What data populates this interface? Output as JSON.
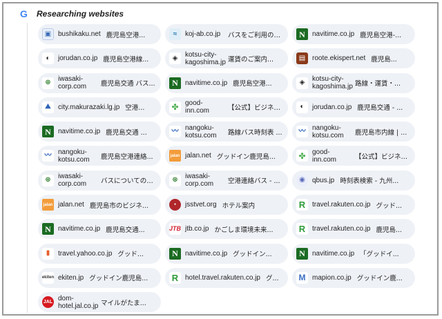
{
  "header": {
    "title": "Researching websites"
  },
  "sources": [
    {
      "domain": "bushikaku.net",
      "desc": "鹿児島空港...",
      "icon": "box-icon",
      "fav": "f-box",
      "glyph": "▣"
    },
    {
      "domain": "koj-ab.co.jp",
      "desc": "バスをご利用の方 ...",
      "icon": "wave-icon",
      "fav": "f-koj",
      "glyph": "≈",
      "wrap": true
    },
    {
      "domain": "navitime.co.jp",
      "desc": "鹿児島空港-...",
      "icon": "navitime-icon",
      "fav": "f-navi",
      "glyph": "N"
    },
    {
      "domain": "jorudan.co.jp",
      "desc": "鹿児島空港線...",
      "icon": "jorudan-icon",
      "fav": "f-jorudan",
      "glyph": "◐"
    },
    {
      "domain": "kotsu-city-kagoshima.jp",
      "desc": "運賃のご案内...",
      "icon": "kotsu-city-icon",
      "fav": "f-kotsu",
      "glyph": "◈",
      "wrap": true
    },
    {
      "domain": "roote.ekispert.net",
      "desc": "鹿児島...",
      "icon": "roote-icon",
      "fav": "f-roote",
      "glyph": "▤"
    },
    {
      "domain": "iwasaki-corp.com",
      "desc": "鹿児島交通 バス...",
      "icon": "iwasaki-icon",
      "fav": "f-iwasaki",
      "glyph": "⊛",
      "wrap": true
    },
    {
      "domain": "navitime.co.jp",
      "desc": "鹿児島空港...",
      "icon": "navitime-icon",
      "fav": "f-navi",
      "glyph": "N"
    },
    {
      "domain": "kotsu-city-kagoshima.jp",
      "desc": "路線・運賃・...",
      "icon": "kotsu-city-icon",
      "fav": "f-kotsu",
      "glyph": "◈",
      "wrap": true
    },
    {
      "domain": "city.makurazaki.lg.jp",
      "desc": "空港...",
      "icon": "city-makurazaki-icon",
      "fav": "f-city",
      "glyph": "⛰"
    },
    {
      "domain": "good-inn.com",
      "desc": "【公式】ビジネス...",
      "icon": "clover-icon",
      "fav": "f-good",
      "glyph": "✤",
      "wrap": true
    },
    {
      "domain": "jorudan.co.jp",
      "desc": "鹿児島交通 - ...",
      "icon": "jorudan-icon",
      "fav": "f-jorudan",
      "glyph": "◐"
    },
    {
      "domain": "navitime.co.jp",
      "desc": "鹿児島交通 ...",
      "icon": "navitime-icon",
      "fav": "f-navi",
      "glyph": "N"
    },
    {
      "domain": "nangoku-kotsu.com",
      "desc": "路線バス時刻表 ...",
      "icon": "nangoku-icon",
      "fav": "f-nangoku",
      "glyph": "〰",
      "wrap": true
    },
    {
      "domain": "nangoku-kotsu.com",
      "desc": "鹿児島市内線 | ...",
      "icon": "nangoku-icon",
      "fav": "f-nangoku",
      "glyph": "〰",
      "wrap": true
    },
    {
      "domain": "nangoku-kotsu.com",
      "desc": "鹿児島空港連絡...",
      "icon": "nangoku-icon",
      "fav": "f-nangoku",
      "glyph": "〰",
      "wrap": true
    },
    {
      "domain": "jalan.net",
      "desc": "グッドイン鹿児島...",
      "icon": "jalan-icon",
      "fav": "f-jalan",
      "glyph": "jalan"
    },
    {
      "domain": "good-inn.com",
      "desc": "【公式】ビジネス...",
      "icon": "clover-icon",
      "fav": "f-good",
      "glyph": "✤",
      "wrap": true
    },
    {
      "domain": "iwasaki-corp.com",
      "desc": "バスについての情...",
      "icon": "iwasaki-icon",
      "fav": "f-iwasaki",
      "glyph": "⊛",
      "wrap": true
    },
    {
      "domain": "iwasaki-corp.com",
      "desc": "空港連絡バス - ...",
      "icon": "iwasaki-icon",
      "fav": "f-iwasaki",
      "glyph": "⊛",
      "wrap": true
    },
    {
      "domain": "qbus.jp",
      "desc": "時刻表検索 - 九州...",
      "icon": "qbus-icon",
      "fav": "f-qbus",
      "glyph": "◉"
    },
    {
      "domain": "jalan.net",
      "desc": "鹿児島市のビジネ...",
      "icon": "jalan-icon",
      "fav": "f-jalan",
      "glyph": "jalan"
    },
    {
      "domain": "jsstvet.org",
      "desc": "ホテル案内",
      "icon": "jsstvet-icon",
      "fav": "f-jsst",
      "glyph": "●"
    },
    {
      "domain": "travel.rakuten.co.jp",
      "desc": "グッド...",
      "icon": "rakuten-icon",
      "fav": "f-rak",
      "glyph": "R"
    },
    {
      "domain": "navitime.co.jp",
      "desc": "鹿児島交通...",
      "icon": "navitime-icon",
      "fav": "f-navi",
      "glyph": "N"
    },
    {
      "domain": "jtb.co.jp",
      "desc": "かごしま環境未来...",
      "icon": "jtb-icon",
      "fav": "f-jtb",
      "glyph": "JTB"
    },
    {
      "domain": "travel.rakuten.co.jp",
      "desc": "鹿児島...",
      "icon": "rakuten-icon",
      "fav": "f-rak",
      "glyph": "R"
    },
    {
      "domain": "travel.yahoo.co.jp",
      "desc": "グッド...",
      "icon": "yahoo-travel-icon",
      "fav": "f-yahoo",
      "glyph": "▮"
    },
    {
      "domain": "navitime.co.jp",
      "desc": "グッドイン...",
      "icon": "navitime-icon",
      "fav": "f-navi",
      "glyph": "N"
    },
    {
      "domain": "navitime.co.jp",
      "desc": "「グッドイ...",
      "icon": "navitime-icon",
      "fav": "f-navi",
      "glyph": "N"
    },
    {
      "domain": "ekiten.jp",
      "desc": "グッドイン鹿児島...",
      "icon": "ekiten-icon",
      "fav": "f-ekiten",
      "glyph": "ekiten"
    },
    {
      "domain": "hotel.travel.rakuten.co.jp",
      "desc": "グ...",
      "icon": "rakuten-icon",
      "fav": "f-rak",
      "glyph": "R"
    },
    {
      "domain": "mapion.co.jp",
      "desc": "グッドイン鹿...",
      "icon": "mapion-icon",
      "fav": "f-mapion",
      "glyph": "M"
    },
    {
      "domain": "dom-hotel.jal.co.jp",
      "desc": "マイルがたま...",
      "icon": "jal-icon",
      "fav": "f-jal",
      "glyph": "JAL",
      "wrap": true
    }
  ]
}
